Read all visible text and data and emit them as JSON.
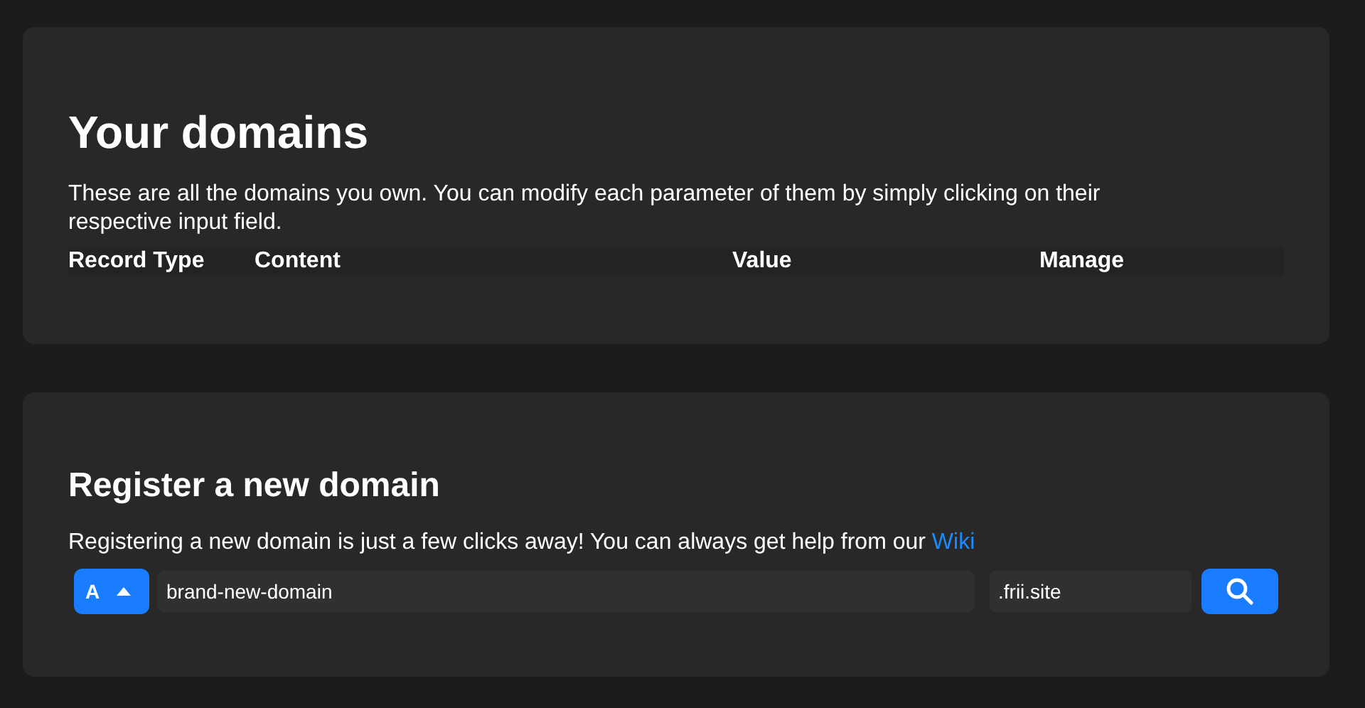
{
  "domains_card": {
    "title": "Your domains",
    "description": "These are all the domains you own. You can modify each parameter of them by simply clicking on their respective input field.",
    "table": {
      "columns": [
        "Record Type",
        "Content",
        "Value",
        "Manage"
      ]
    }
  },
  "register_card": {
    "title": "Register a new domain",
    "description": "Registering a new domain is just a few clicks away! You can always get help from our ",
    "link": "Wiki",
    "record_type": "A",
    "domain_value": "brand-new-domain",
    "suffix_value": ".frii.site"
  }
}
